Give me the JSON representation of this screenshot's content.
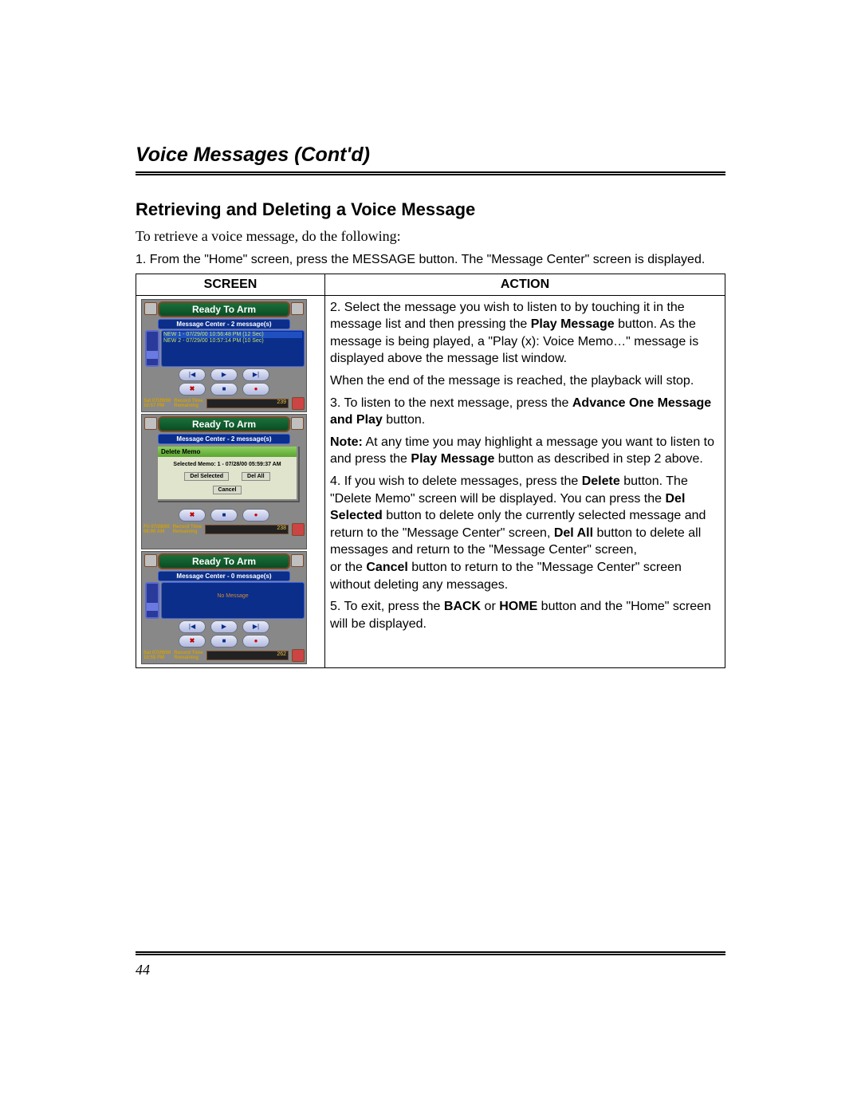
{
  "header": "Voice Messages (Cont'd)",
  "subheader": "Retrieving and Deleting a Voice Message",
  "intro": "To retrieve a voice message, do the following:",
  "step1": "1. From the \"Home\" screen, press the MESSAGE button. The \"Message Center\" screen is displayed.",
  "table": {
    "col_screen": "SCREEN",
    "col_action": "ACTION"
  },
  "action": {
    "p1_a": "2. Select the message you wish to listen to by touching it in the message list and then pressing the ",
    "p1_bold1": "Play Message",
    "p1_b": " button. As the message is being played, a \"Play (x): Voice Memo…\" message is displayed above the message list window.",
    "p2": "When the end of the message is reached, the playback will stop.",
    "p3_a": "3. To listen to the next message, press the ",
    "p3_bold1": "Advance One Message and Play",
    "p3_b": " button.",
    "p4_bold1": "Note:",
    "p4_a": " At any time you may highlight a message you want to listen to and press the ",
    "p4_bold2": "Play Message",
    "p4_b": " button as described in step 2 above.",
    "p5_a": "4. If you wish to delete messages, press the ",
    "p5_bold1": "Delete",
    "p5_b": " button. The \"Delete Memo\" screen will be displayed. You can press the ",
    "p5_bold2": "Del Selected",
    "p5_c": " button to delete only the currently selected message and return to the \"Message Center\" screen, ",
    "p5_bold3": "Del All",
    "p5_d": " button to delete all messages and return to the \"Message Center\" screen,",
    "p5_e": "or the ",
    "p5_bold4": "Cancel",
    "p5_f": " button to return to the \"Message Center\" screen without deleting any messages.",
    "p6_a": "5. To exit, press the ",
    "p6_bold1": "BACK",
    "p6_b": " or ",
    "p6_bold2": "HOME",
    "p6_c": " button and the \"Home\" screen will be displayed."
  },
  "screens": {
    "s1": {
      "title": "Ready To Arm",
      "center": "Message Center - 2 message(s)",
      "msg1": "NEW 1  - 07/29/00 10:56:48 PM (12 Sec)",
      "msg2": "NEW 2  - 07/29/00 10:57:14 PM (10 Sec)",
      "ts1": "Sat 07/29/00",
      "ts2": "10:57 PM",
      "lbl1": "Record Time",
      "lbl2": "Remaining",
      "meter": "239"
    },
    "s2": {
      "title": "Ready To Arm",
      "center": "Message Center - 2 message(s)",
      "dlg_title": "Delete Memo",
      "dlg_body": "Selected Memo: 1  - 07/28/00 05:59:37 AM",
      "dlg_btn1": "Del Selected",
      "dlg_btn2": "Del All",
      "dlg_btn3": "Cancel",
      "ts1": "Fri 07/28/00",
      "ts2": "06:00 AM",
      "lbl1": "Record Time",
      "lbl2": "Remaining",
      "meter": "238"
    },
    "s3": {
      "title": "Ready To Arm",
      "center": "Message Center - 0 message(s)",
      "no_msg": "No Message",
      "ts1": "Sat 07/29/00",
      "ts2": "10:55 PM",
      "lbl1": "Record Time",
      "lbl2": "Remaining",
      "meter": "262"
    }
  },
  "page_number": "44"
}
